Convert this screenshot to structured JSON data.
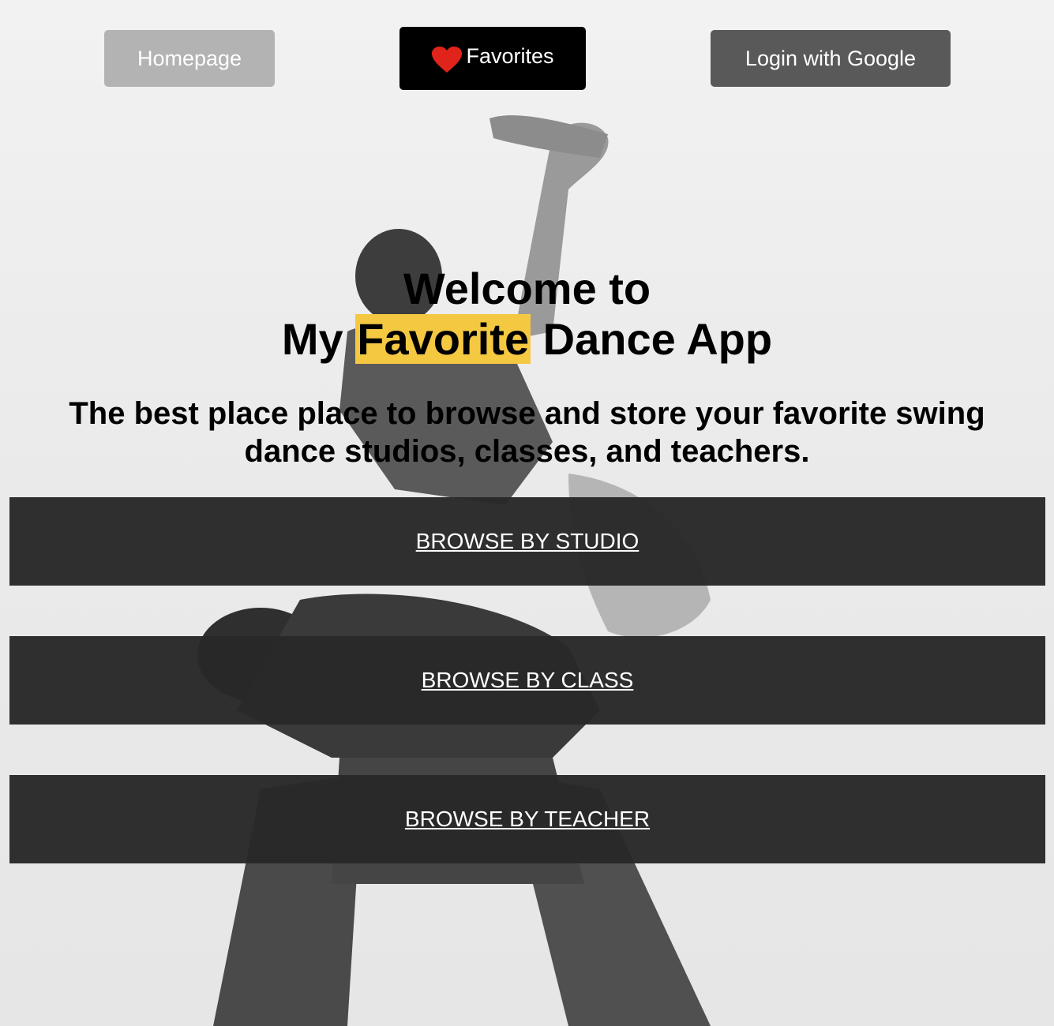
{
  "nav": {
    "homepage_label": "Homepage",
    "favorites_label": "Favorites",
    "login_label": "Login with Google"
  },
  "hero": {
    "line1": "Welcome to",
    "line2_before": "My",
    "line2_highlight": "Favorite",
    "line2_after": "Dance App",
    "tagline": "The best place place to browse and store your favorite swing dance studios, classes, and teachers."
  },
  "browse": {
    "studio_label": "BROWSE BY STUDIO",
    "class_label": "BROWSE BY CLASS",
    "teacher_label": "BROWSE BY TEACHER"
  },
  "icons": {
    "favorites_icon": "heart-icon"
  },
  "colors": {
    "highlight": "#f5c842",
    "heart": "#e0241b",
    "bar": "#282828"
  }
}
